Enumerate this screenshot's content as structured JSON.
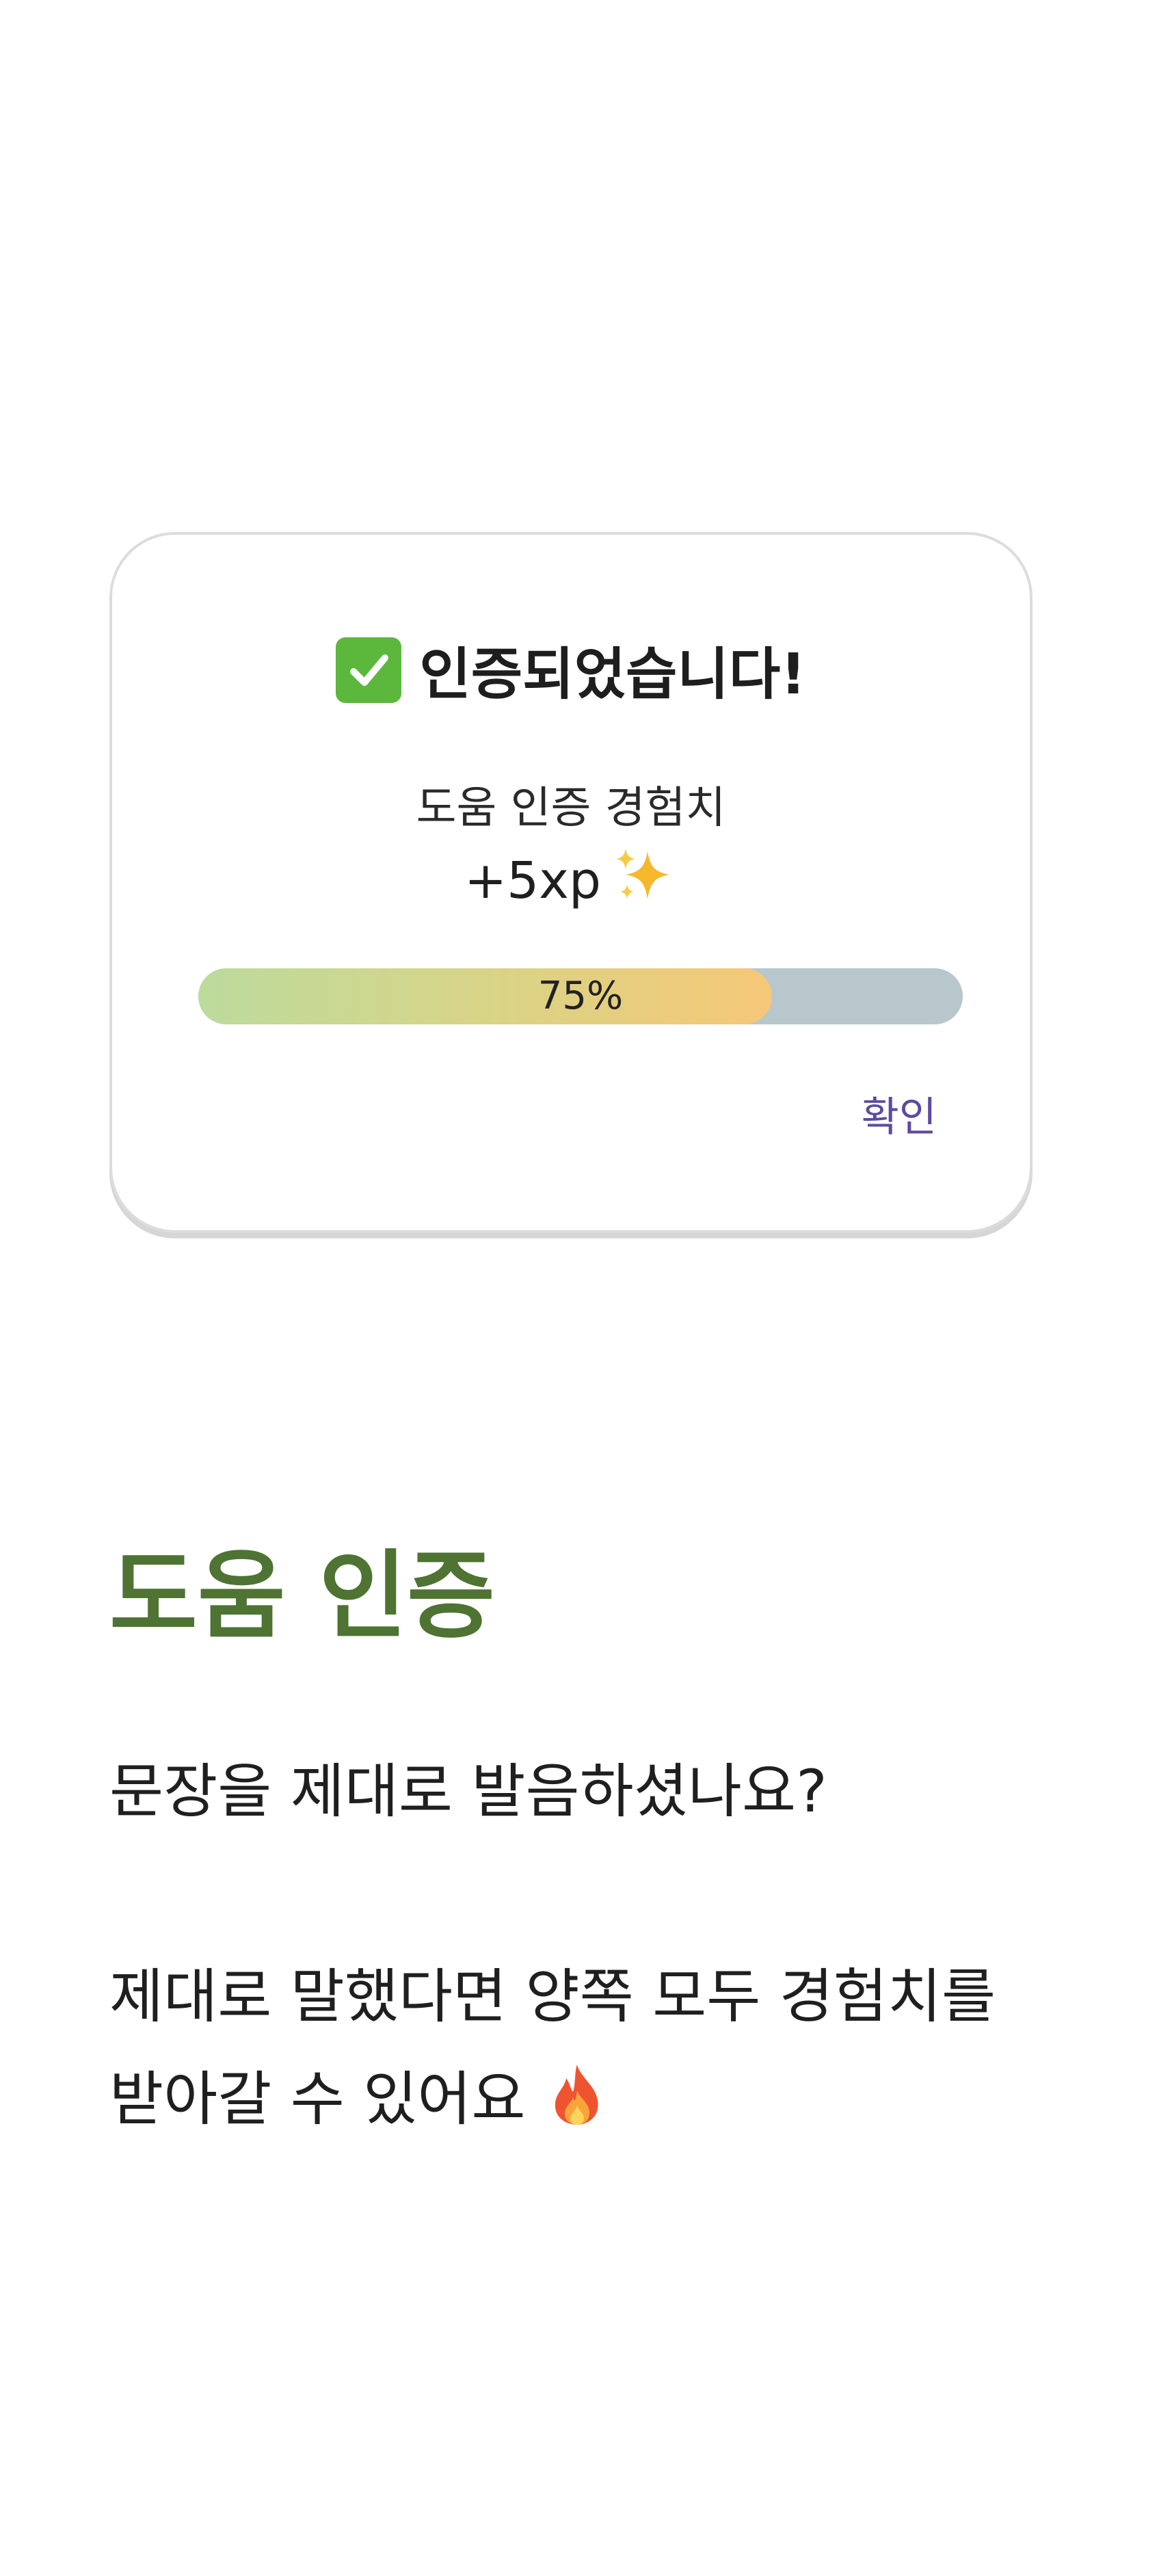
{
  "dialog": {
    "title": "인증되었습니다!",
    "subtitle": "도움 인증 경험치",
    "xp": "+5xp",
    "progress": {
      "value": 0.75,
      "label": "75%"
    },
    "confirm_label": "확인"
  },
  "section": {
    "title": "도움 인증",
    "question": "문장을 제대로 발음하셨나요?",
    "line1": "제대로 말했다면 양쪽 모두 경험치를",
    "line2": "받아갈 수 있어요"
  },
  "icons": {
    "title_icon": "check-mark-icon",
    "xp_icon": "sparkles-icon",
    "body_icon": "fire-icon"
  },
  "colors": {
    "accent_green": "#4e7332",
    "confirm_purple": "#5e4aa0",
    "progress_track": "#b7c7cc",
    "progress_start": "#bcdb9c",
    "progress_end": "#f6c777"
  }
}
